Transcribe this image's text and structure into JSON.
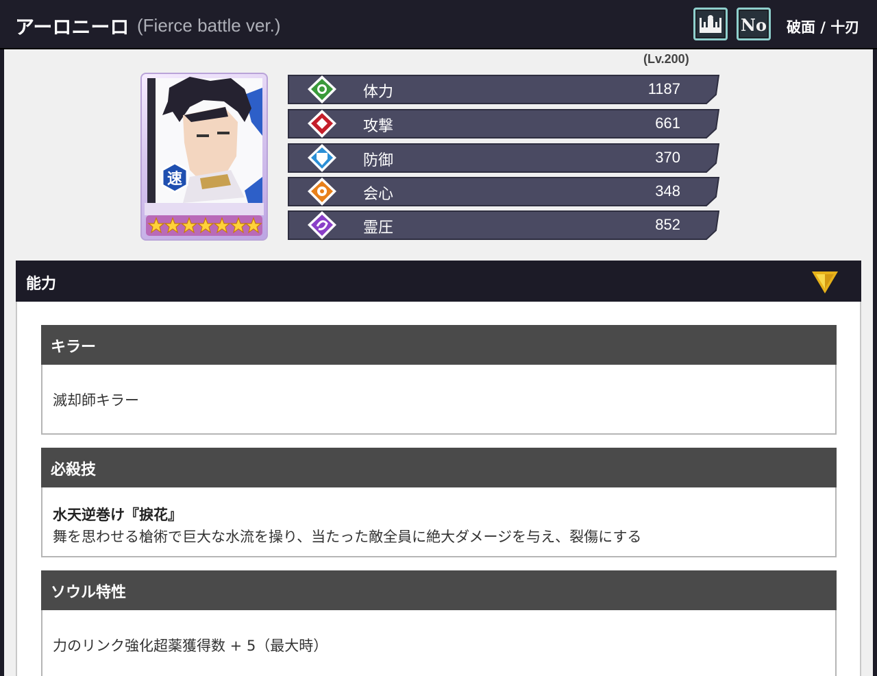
{
  "header": {
    "name": "アーロニーロ",
    "variant": "(Fierce battle ver.)",
    "faction": "破面 / 十刃"
  },
  "toolbar": {
    "castle_icon": "castle-icon",
    "number_icon": "number-icon",
    "number_label": "No"
  },
  "character": {
    "level": "(Lv.200)",
    "type_badge": "速",
    "stars": 6,
    "stats": [
      {
        "label": "体力",
        "value": "1187",
        "color": "#3a9a3a",
        "icon": "hp-icon"
      },
      {
        "label": "攻撃",
        "value": "661",
        "color": "#c41e2a",
        "icon": "attack-icon"
      },
      {
        "label": "防御",
        "value": "370",
        "color": "#2b8fd6",
        "icon": "defense-icon"
      },
      {
        "label": "会心",
        "value": "348",
        "color": "#e8801a",
        "icon": "critical-icon"
      },
      {
        "label": "霊圧",
        "value": "852",
        "color": "#8a3fc8",
        "icon": "reiatsu-icon"
      }
    ]
  },
  "abilities": {
    "title": "能力",
    "killer": {
      "heading": "キラー",
      "text": "滅却師キラー"
    },
    "special": {
      "heading": "必殺技",
      "name": "水天逆巻け『捩花』",
      "description": "舞を思わせる槍術で巨大な水流を操り、当たった敵全員に絶大ダメージを与え、裂傷にする"
    },
    "soul": {
      "heading": "ソウル特性",
      "text": "力のリンク強化超薬獲得数 + 5（最大時）"
    }
  }
}
